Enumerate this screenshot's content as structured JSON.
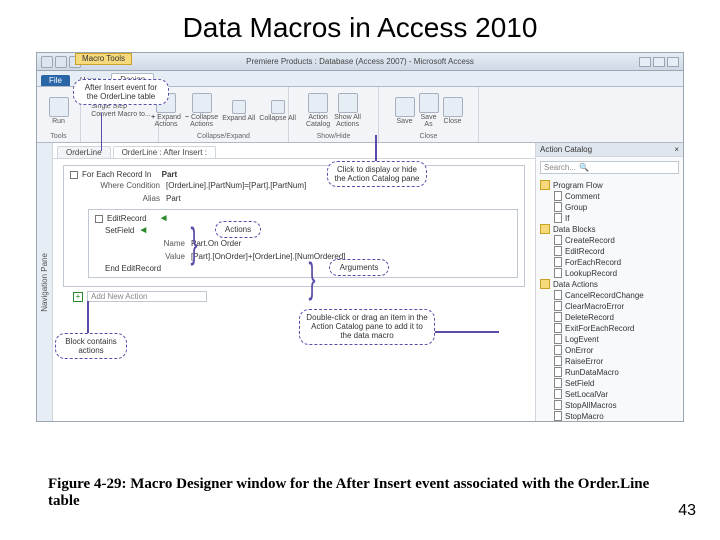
{
  "slide": {
    "title": "Data Macros in Access 2010",
    "page_number": "43"
  },
  "caption": "Figure 4-29: Macro Designer window for the After Insert event associated with the Order.Line table",
  "window": {
    "title": "Premiere Products : Database (Access 2007) - Microsoft Access",
    "contextual_tab": "Macro Tools",
    "tabs": {
      "file": "File",
      "home": "Home",
      "design": "Design"
    },
    "doc_tabs": {
      "tab1": "OrderLine",
      "tab2": "OrderLine : After Insert :"
    }
  },
  "ribbon": {
    "run": "Run",
    "tools": "Tools",
    "single_step": "Single Step",
    "convert": "Convert Macro to...",
    "expand_actions": "Expand Actions",
    "collapse_actions": "Collapse Actions",
    "expand_all": "Expand All",
    "collapse_all": "Collapse All",
    "collapse_expand_group": "Collapse/Expand",
    "action_catalog": "Action Catalog",
    "show_all": "Show All Actions",
    "show_hide": "Show/Hide",
    "save": "Save",
    "save_as": "Save As",
    "close": "Close",
    "close_group": "Close"
  },
  "nav_pane": "Navigation Pane",
  "macro": {
    "foreach": "For Each Record In",
    "foreach_target": "Part",
    "where_label": "Where Condition",
    "where_val": "[OrderLine].[PartNum]=[Part].[PartNum]",
    "alias_label": "Alias",
    "alias_val": "Part",
    "edit_record": "EditRecord",
    "setfield": "SetField",
    "name_label": "Name",
    "name_val": "Part.On Order",
    "value_label": "Value",
    "value_val": "[Part].[OnOrder]+[OrderLine].[NumOrdered]",
    "end_edit": "End EditRecord",
    "add_new": "Add New Action"
  },
  "catalog": {
    "title": "Action Catalog",
    "search": "Search...",
    "program_flow": "Program Flow",
    "pf": {
      "comment": "Comment",
      "group": "Group",
      "if": "If"
    },
    "data_blocks": "Data Blocks",
    "db": {
      "create": "CreateRecord",
      "edit": "EditRecord",
      "foreach": "ForEachRecord",
      "lookup": "LookupRecord"
    },
    "data_actions": "Data Actions",
    "da": {
      "cancel": "CancelRecordChange",
      "clear": "ClearMacroError",
      "delete": "DeleteRecord",
      "exit": "ExitForEachRecord",
      "log": "LogEvent",
      "onerror": "OnError",
      "raise": "RaiseError",
      "run": "RunDataMacro",
      "setf": "SetField",
      "setl": "SetLocalVar",
      "stopall": "StopAllMacros",
      "stop": "StopMacro"
    }
  },
  "callouts": {
    "insert_event": "After Insert event for the OrderLine table",
    "show_hide": "Click to display or hide the Action Catalog pane",
    "actions": "Actions",
    "arguments": "Arguments",
    "drag": "Double-click or drag an item in the Action Catalog pane to add it to the data macro",
    "block_actions": "Block contains actions"
  }
}
